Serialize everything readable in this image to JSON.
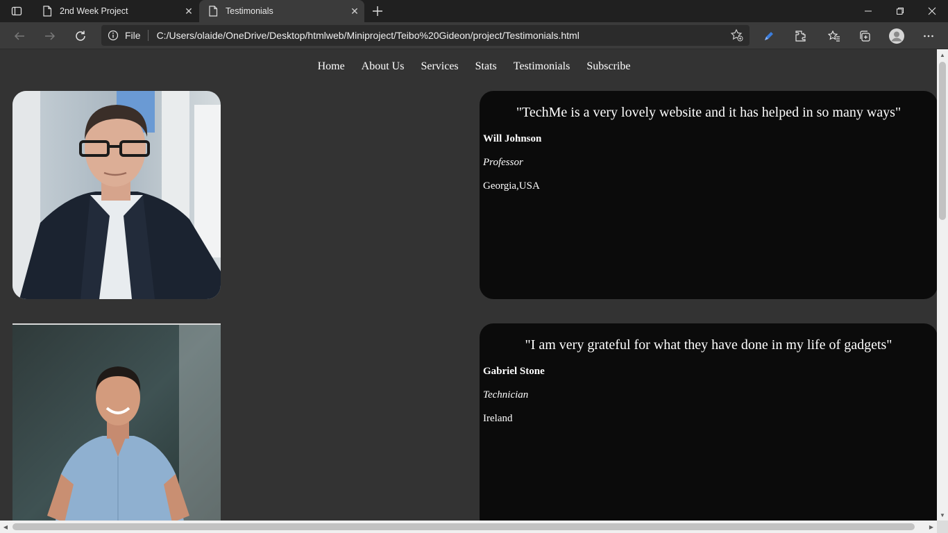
{
  "browser": {
    "tabs": [
      {
        "title": "2nd Week Project",
        "icon": "page-icon",
        "active": false
      },
      {
        "title": "Testimonials",
        "icon": "page-icon",
        "active": true
      }
    ],
    "address_label": "File",
    "address_url": "C:/Users/olaide/OneDrive/Desktop/htmlweb/Miniproject/Teibo%20Gideon/project/Testimonials.html"
  },
  "nav": {
    "items": [
      "Home",
      "About Us",
      "Services",
      "Stats",
      "Testimonials",
      "Subscribe"
    ]
  },
  "testimonials": [
    {
      "quote": "\"TechMe is a very lovely website and it has helped in so many ways\"",
      "name": "Will Johnson",
      "role": "Professor",
      "location": "Georgia,USA",
      "photo": "portrait of a man with glasses in a dark suit"
    },
    {
      "quote": "\"I am very grateful for what they have done in my life of gadgets\"",
      "name": "Gabriel Stone",
      "role": "Technician",
      "location": "Ireland",
      "photo": "smiling man in a light blue shirt"
    }
  ],
  "colors": {
    "page_bg": "#333333",
    "card_bg": "#0b0b0b",
    "text": "#ffffff",
    "tabbar_bg": "#202020",
    "toolbar_bg": "#3b3b3b"
  }
}
